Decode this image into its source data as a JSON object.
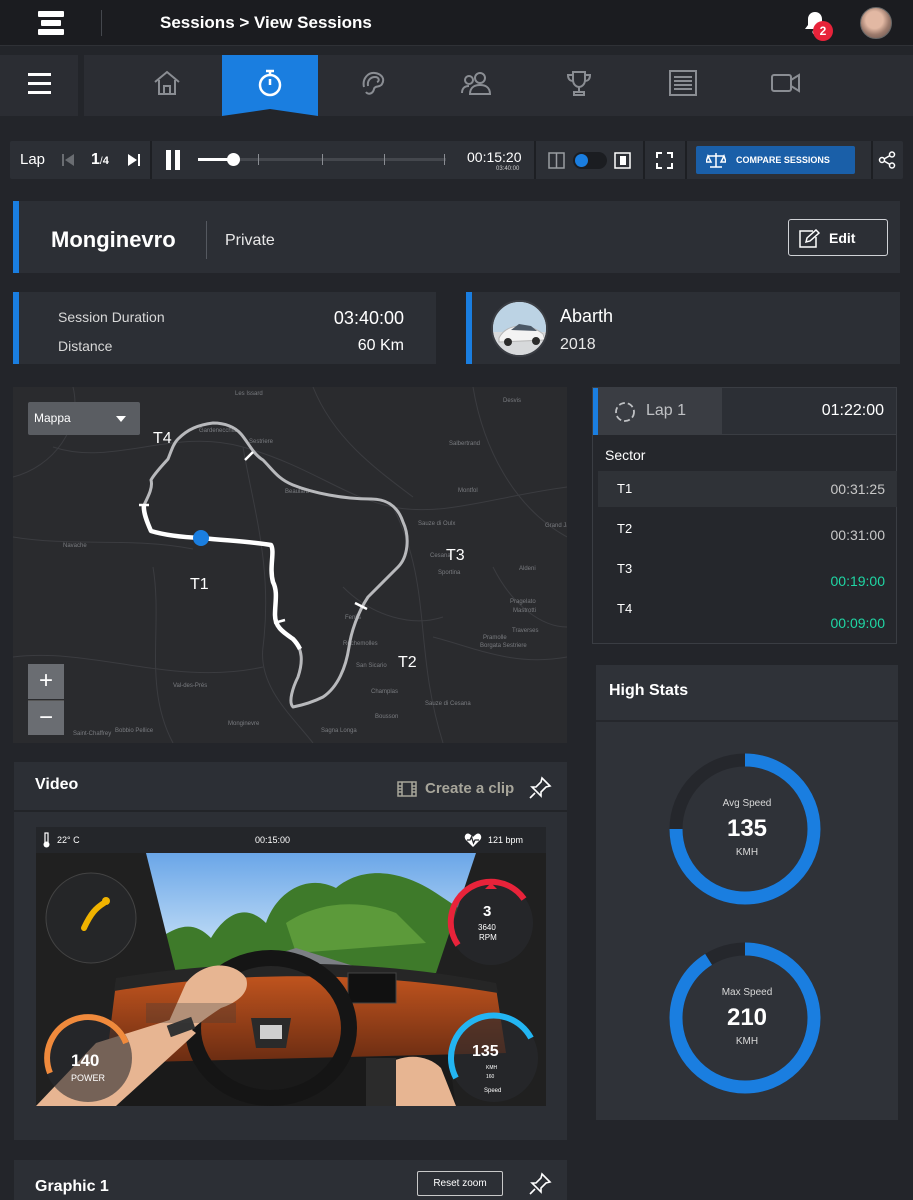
{
  "header": {
    "breadcrumb": "Sessions > View Sessions",
    "notifications": "2"
  },
  "nav": {
    "items": [
      "home-icon",
      "stopwatch-icon",
      "track-icon",
      "users-icon",
      "trophy-icon",
      "list-icon",
      "video-icon"
    ],
    "active": "stopwatch-icon"
  },
  "player": {
    "lap_label": "Lap",
    "lap_current": "1",
    "lap_total": "4",
    "time": "00:15:20",
    "time_total": "03:40:00",
    "progress": 0.14,
    "compare_label": "COMPARE SESSIONS"
  },
  "session": {
    "name": "Monginevro",
    "visibility": "Private",
    "edit_label": "Edit"
  },
  "stats": {
    "duration_label": "Session Duration",
    "duration": "03:40:00",
    "distance_label": "Distance",
    "distance": "60 Km"
  },
  "car": {
    "make": "Abarth",
    "year": "2018"
  },
  "map": {
    "select": "Mappa",
    "zoom_in": "+",
    "zoom_out": "−",
    "turns": [
      "T4",
      "T1",
      "T3",
      "T2"
    ],
    "places": [
      "Les Issard",
      "Desvis",
      "Gardenecchia",
      "Sestriere",
      "Beaulard",
      "Salbertrand",
      "Sauze di Oulx",
      "Montfol",
      "Navache",
      "Cesana",
      "Sportina",
      "Grand Jan",
      "Aldeni",
      "Pragelato",
      "Traverses",
      "Mastrotti",
      "Fenils",
      "Pramolle",
      "Borgata Sestriere",
      "San Sicario",
      "Rochemolles",
      "Champlas",
      "Sauze di Cesana",
      "Bousson",
      "Monginevre",
      "Sagna Longa",
      "Val-des-Prés",
      "Saint-Chaffrey",
      "Bobbio Pellice"
    ]
  },
  "lap": {
    "label": "Lap 1",
    "time": "01:22:00",
    "sector_title": "Sector",
    "sectors": [
      {
        "name": "T1",
        "time": "00:31:25",
        "color": "#c8c8c8"
      },
      {
        "name": "T2",
        "time": "00:31:00",
        "color": "#c8c8c8"
      },
      {
        "name": "T3",
        "time": "00:19:00",
        "color": "#1fd6a4"
      },
      {
        "name": "T4",
        "time": "00:09:00",
        "color": "#1fd6a4"
      }
    ]
  },
  "high_stats": {
    "title": "High Stats",
    "avg": {
      "label": "Avg Speed",
      "value": "135",
      "unit": "KMH"
    },
    "max": {
      "label": "Max Speed",
      "value": "210",
      "unit": "KMH"
    }
  },
  "video": {
    "title": "Video",
    "clip_label": "Create a clip",
    "temp": "22° C",
    "time": "00:15:00",
    "heart": "121 bpm",
    "power": "140",
    "power_label": "POWER",
    "gear": "3",
    "rpm": "3640",
    "rpm_label": "RPM",
    "speed": "135",
    "speed_unit": "KMH",
    "speed_max": "160",
    "speed_label": "Speed"
  },
  "graphic": {
    "title": "Graphic 1",
    "reset_label": "Reset zoom"
  },
  "colors": {
    "accent": "#1a7ee0",
    "good": "#1fd6a4",
    "alert": "#e8233a",
    "power": "#f08a3c"
  }
}
